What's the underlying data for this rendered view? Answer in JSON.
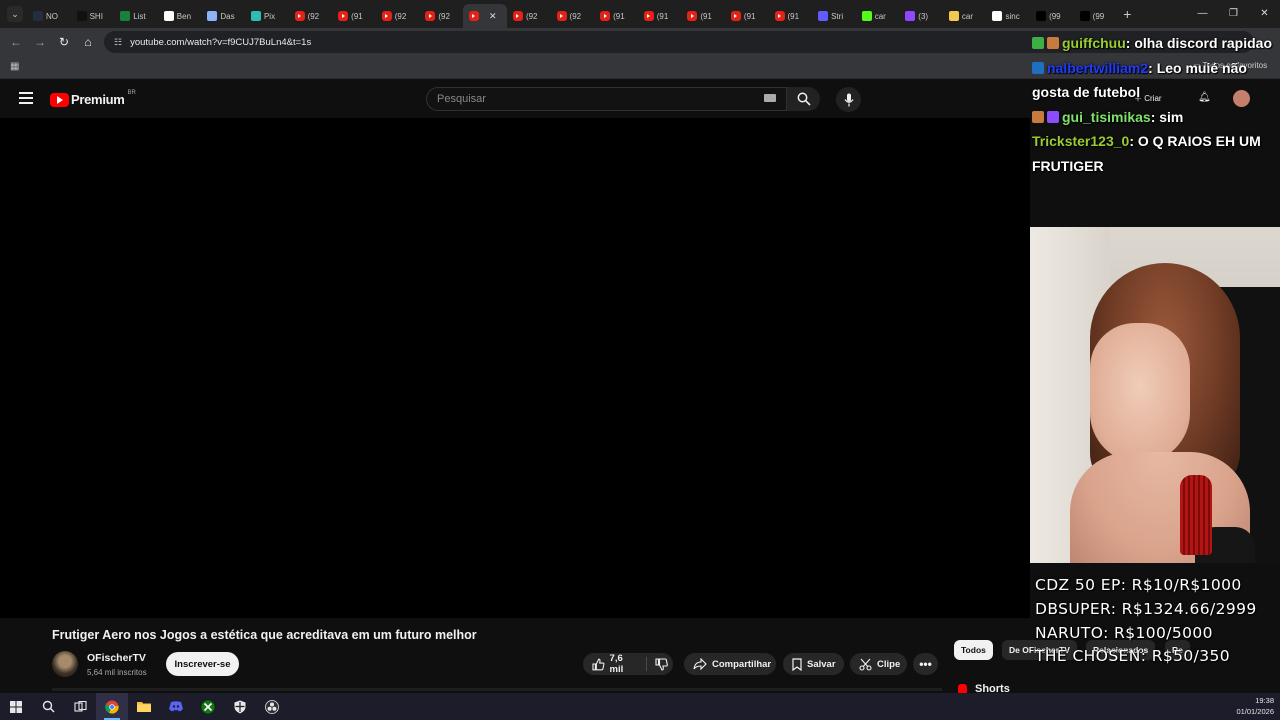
{
  "browser": {
    "tabs": [
      {
        "label": "NO",
        "icon": "amazon-icon",
        "color": "#232f3e"
      },
      {
        "label": "SHI",
        "icon": "shein-icon",
        "color": "#111111"
      },
      {
        "label": "List",
        "icon": "sheets-icon",
        "color": "#188038"
      },
      {
        "label": "Ben",
        "icon": "notion-icon",
        "color": "#ffffff"
      },
      {
        "label": "Das",
        "icon": "globe-icon",
        "color": "#8ab4f8"
      },
      {
        "label": "Pix",
        "icon": "pix-icon",
        "color": "#32bcad"
      },
      {
        "label": "(92",
        "icon": "youtube-icon",
        "color": "#e62117"
      },
      {
        "label": "(91",
        "icon": "youtube-icon",
        "color": "#e62117"
      },
      {
        "label": "(92",
        "icon": "youtube-icon",
        "color": "#e62117"
      },
      {
        "label": "(92",
        "icon": "youtube-icon",
        "color": "#e62117"
      },
      {
        "label": "",
        "icon": "youtube-icon",
        "color": "#e62117",
        "active": true
      },
      {
        "label": "(92",
        "icon": "youtube-icon",
        "color": "#e62117"
      },
      {
        "label": "(92",
        "icon": "youtube-icon",
        "color": "#e62117"
      },
      {
        "label": "(91",
        "icon": "youtube-icon",
        "color": "#e62117"
      },
      {
        "label": "(91",
        "icon": "youtube-icon",
        "color": "#e62117"
      },
      {
        "label": "(91",
        "icon": "youtube-icon",
        "color": "#e62117"
      },
      {
        "label": "(91",
        "icon": "youtube-icon",
        "color": "#e62117"
      },
      {
        "label": "(91",
        "icon": "youtube-icon",
        "color": "#e62117"
      },
      {
        "label": "Stri",
        "icon": "stripe-icon",
        "color": "#635bff"
      },
      {
        "label": "car",
        "icon": "kick-icon",
        "color": "#53fc18"
      },
      {
        "label": "(3)",
        "icon": "twitch-icon",
        "color": "#9146ff"
      },
      {
        "label": "car",
        "icon": "chat-icon",
        "color": "#f2c94c"
      },
      {
        "label": "sinc",
        "icon": "google-icon",
        "color": "#ffffff"
      },
      {
        "label": "(99",
        "icon": "tiktok-icon",
        "color": "#000000"
      },
      {
        "label": "(99",
        "icon": "tiktok-icon",
        "color": "#000000"
      }
    ],
    "close_glyph": "✕",
    "new_tab_glyph": "+",
    "url": "youtube.com/watch?v=f9CUJ7BuLn4&t=1s",
    "bookmarks_label": "Todos os favoritos"
  },
  "youtube": {
    "brand": "Premium",
    "country": "BR",
    "search_placeholder": "Pesquisar",
    "create_label": "Criar",
    "video_title": "Frutiger Aero nos Jogos a estética que acreditava em um futuro melhor",
    "channel": "OFischerTV",
    "subscribers": "5,64 mil inscritos",
    "subscribe_label": "Inscrever-se",
    "likes": "7,6 mil",
    "share_label": "Compartilhar",
    "save_label": "Salvar",
    "clip_label": "Clipe",
    "chips": [
      "Todos",
      "De OFischerTV",
      "Relacionados",
      "Re"
    ],
    "shorts_label": "Shorts"
  },
  "overlay": {
    "chat": [
      {
        "user": "guiffchuu",
        "user_color": "#9acd32",
        "text": ": olha discord rapidao"
      },
      {
        "user": "nalbertwilliam2",
        "user_color": "#1f3bff",
        "text": ": Leo muié não gosta de futebol"
      },
      {
        "user": "gui_tisimikas",
        "user_color": "#7fe26a",
        "text": ": sim"
      },
      {
        "user": "Trickster123_0",
        "user_color": "#9acd32",
        "text": ": O Q RAIOS EH UM FRUTIGER"
      }
    ],
    "goals": [
      "CDZ 50 EP: R$10/R$1000",
      "DBSUPER: R$1324.66/2999",
      "NARUTO: R$100/5000",
      "THE CHOSEN: R$50/350"
    ]
  },
  "taskbar": {
    "time": "19:38",
    "date": "01/01/2026"
  }
}
